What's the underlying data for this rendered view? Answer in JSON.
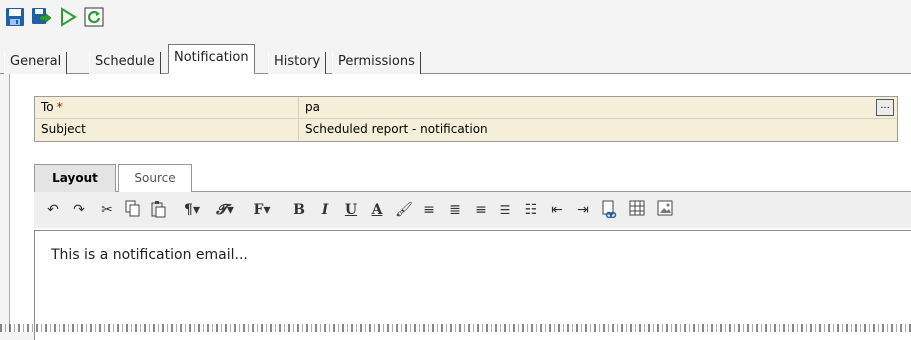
{
  "toolbar": {
    "buttons": [
      {
        "name": "save-icon"
      },
      {
        "name": "save-as-icon"
      },
      {
        "name": "run-icon"
      },
      {
        "name": "refresh-icon"
      }
    ]
  },
  "tabs": {
    "general": "General",
    "schedule": "Schedule",
    "notification": "Notification",
    "history": "History",
    "permissions": "Permissions"
  },
  "form": {
    "to_label": "To",
    "required_mark": "*",
    "to_value": "pa",
    "browse_label": "...",
    "subject_label": "Subject",
    "subject_value": "Scheduled report - notification"
  },
  "editor": {
    "tab_layout": "Layout",
    "tab_source": "Source",
    "body_text": "This is a notification email..."
  },
  "colors": {
    "field_bg": "#f5eed9",
    "required": "#d00000",
    "icon_blue": "#1f5fa8",
    "icon_green": "#2e9e2e"
  }
}
